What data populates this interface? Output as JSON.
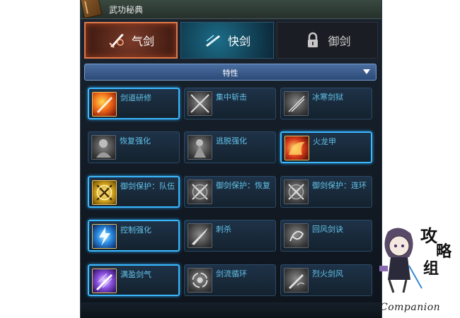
{
  "window": {
    "title": "武功秘典",
    "book_icon": "book-icon"
  },
  "tabs": [
    {
      "label": "气剑",
      "icon": "sword-icon",
      "accent": "#e0784a",
      "state": "selected"
    },
    {
      "label": "快剑",
      "icon": "sword-icon",
      "accent": "#2a8ac0",
      "state": "available"
    },
    {
      "label": "御剑",
      "icon": "lock-icon",
      "accent": "#1a1e24",
      "state": "locked"
    }
  ],
  "category_dropdown": {
    "selected": "特性",
    "icon": "triangle-down-icon",
    "accent": "#4a6ea0"
  },
  "skills": [
    {
      "name": "剑道研修",
      "active": true
    },
    {
      "name": "集中斩击",
      "active": false
    },
    {
      "name": "冰寒剑狱",
      "active": false
    },
    {
      "name": "恢复强化",
      "active": false
    },
    {
      "name": "逃脱强化",
      "active": false
    },
    {
      "name": "火龙甲",
      "active": true
    },
    {
      "name": "御剑保护：队伍",
      "active": true
    },
    {
      "name": "御剑保护：恢复",
      "active": false
    },
    {
      "name": "御剑保护：连环",
      "active": false
    },
    {
      "name": "控制强化",
      "active": true
    },
    {
      "name": "刺杀",
      "active": false
    },
    {
      "name": "回风剑诀",
      "active": false
    },
    {
      "name": "满盈剑气",
      "active": true
    },
    {
      "name": "剑流循环",
      "active": false
    },
    {
      "name": "烈火剑风",
      "active": false
    }
  ],
  "watermark": {
    "glyphs": [
      "攻",
      "略",
      "组"
    ],
    "text": "Companion"
  },
  "colors": {
    "active_border": "#3ab8ff",
    "label": "#62c2e8",
    "panel_bg": "#121a24"
  }
}
